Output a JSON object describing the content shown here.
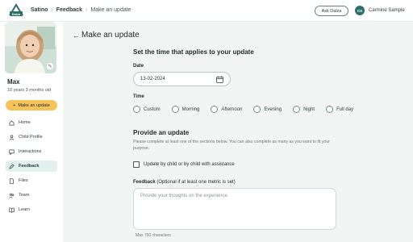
{
  "colors": {
    "brand": "#2f6f6a",
    "accent": "#f4c45a",
    "active_nav": "#e2f0ee",
    "main_bg": "#f3f5f4"
  },
  "logo": {
    "text": "Dalza"
  },
  "breadcrumb": {
    "items": [
      "Satino",
      "Feedback",
      "Make an update"
    ]
  },
  "header": {
    "ask_button": "Ask Dalza",
    "user_initials": "CS",
    "user_name": "Carmine Sample"
  },
  "sidebar": {
    "child_name": "Max",
    "child_age": "10 years 3 months old",
    "make_update_label": "Make an update",
    "items": [
      {
        "label": "Home",
        "icon": "home-icon",
        "active": false
      },
      {
        "label": "Child Profile",
        "icon": "profile-icon",
        "active": false
      },
      {
        "label": "Interactions",
        "icon": "chat-icon",
        "active": false
      },
      {
        "label": "Feedback",
        "icon": "pen-icon",
        "active": true
      },
      {
        "label": "Files",
        "icon": "file-icon",
        "active": false
      },
      {
        "label": "Team",
        "icon": "team-icon",
        "active": false
      },
      {
        "label": "Learn",
        "icon": "book-icon",
        "active": false
      }
    ]
  },
  "main": {
    "title": "Make an update",
    "time_section_title": "Set the time that applies to your update",
    "date_label": "Date",
    "date_value": "13-02-2024",
    "time_label": "Time",
    "time_options": [
      "Custom",
      "Morning",
      "Afternoon",
      "Evening",
      "Night",
      "Full day"
    ],
    "provide_title": "Provide an update",
    "help_text": "Please complete at least one of the sections below. You can also complete as many as you want to fit your purpose.",
    "checkbox_label": "Update by child or by child with assistance",
    "feedback_label_bold": "Feedback",
    "feedback_label_rest": " (Optional if at least one metric is set)",
    "feedback_placeholder": "Provide your thoughts on the experience.",
    "max_chars": "Max 750 characters"
  }
}
